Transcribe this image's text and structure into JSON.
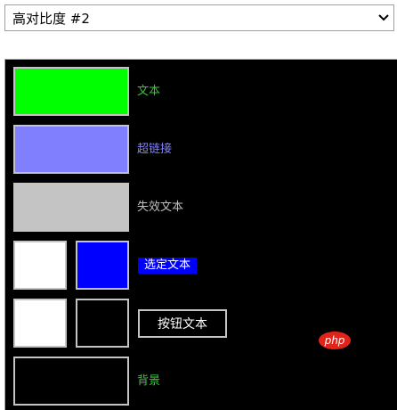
{
  "theme_select": {
    "value": "高对比度 #2"
  },
  "items": {
    "text": {
      "label": "文本",
      "color": "#00ff00",
      "swatch": "#00ff00"
    },
    "hyperlink": {
      "label": "超链接",
      "color": "#8080ff",
      "swatch": "#8080ff"
    },
    "disabled": {
      "label": "失效文本",
      "color": "#c0c0c0",
      "swatch": "#c4c4c4"
    },
    "selected": {
      "label": "选定文本",
      "fg": "#ffffff",
      "bg": "#0000ff",
      "swatch_fg": "#ffffff",
      "swatch_bg": "#0000ff"
    },
    "button": {
      "label": "按钮文本",
      "fg": "#ffffff",
      "bg": "#000000",
      "swatch_fg": "#ffffff",
      "swatch_bg": "#000000"
    },
    "background": {
      "label": "背景",
      "color": "#33cc33",
      "swatch": "#000000"
    }
  },
  "watermark": {
    "text": "php",
    "color": "#e2231a"
  }
}
